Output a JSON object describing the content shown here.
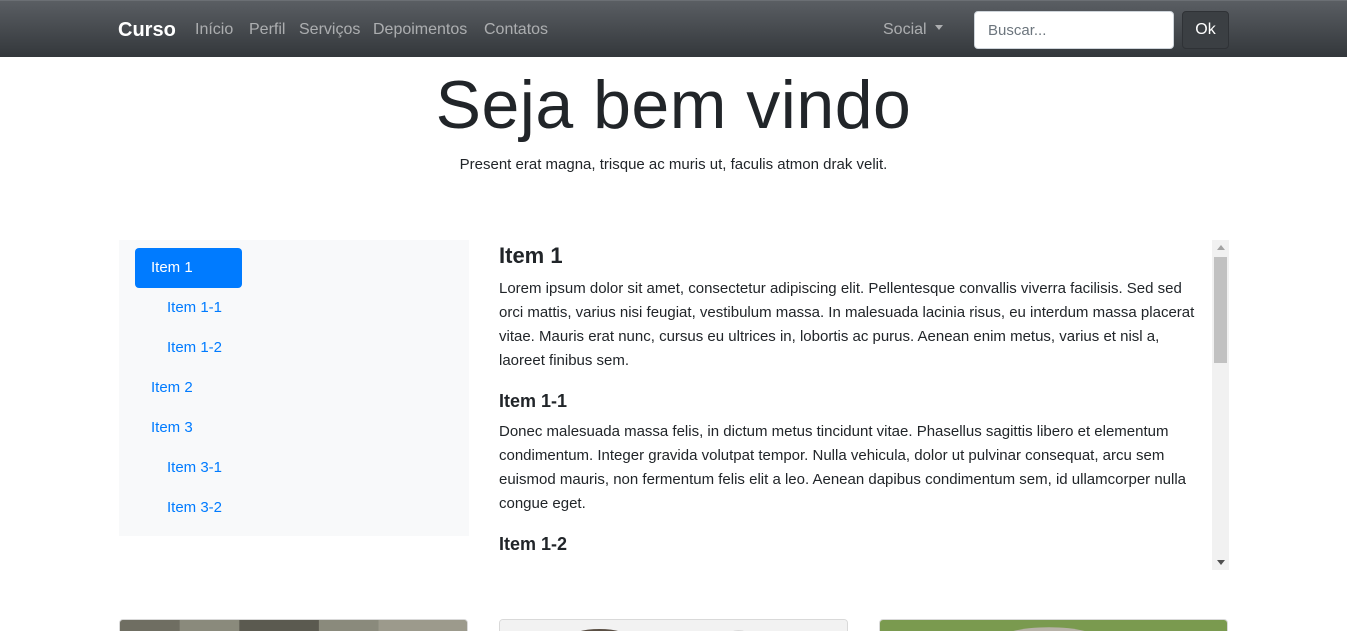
{
  "navbar": {
    "brand": "Curso",
    "links": [
      "Início",
      "Perfil",
      "Serviços",
      "Depoimentos",
      "Contatos"
    ],
    "social_label": "Social",
    "search_placeholder": "Buscar...",
    "search_button": "Ok"
  },
  "hero": {
    "title": "Seja bem vindo",
    "subtitle": "Present erat magna, trisque ac muris ut, faculis atmon drak velit."
  },
  "sidenav": {
    "items": [
      "Item 1",
      "Item 1-1",
      "Item 1-2",
      "Item 2",
      "Item 3",
      "Item 3-1",
      "Item 3-2"
    ],
    "active": "Item 1"
  },
  "content": {
    "sections": [
      {
        "heading": "Item 1",
        "text": "Lorem ipsum dolor sit amet, consectetur adipiscing elit. Pellentesque convallis viverra facilisis. Sed sed orci mattis, varius nisi feugiat, vestibulum massa. In malesuada lacinia risus, eu interdum massa placerat vitae. Mauris erat nunc, cursus eu ultrices in, lobortis ac purus. Aenean enim metus, varius et nisl a, laoreet finibus sem."
      },
      {
        "heading": "Item 1-1",
        "text": "Donec malesuada massa felis, in dictum metus tincidunt vitae. Phasellus sagittis libero et elementum condimentum. Integer gravida volutpat tempor. Nulla vehicula, dolor ut pulvinar consequat, arcu sem euismod mauris, non fermentum felis elit a leo. Aenean dapibus condimentum sem, id ullamcorper nulla congue eget."
      },
      {
        "heading": "Item 1-2",
        "text": ""
      }
    ]
  },
  "colors": {
    "primary": "#007bff",
    "navbar_dark": "#343a40",
    "sidenav_bg": "#f8f9fa"
  }
}
